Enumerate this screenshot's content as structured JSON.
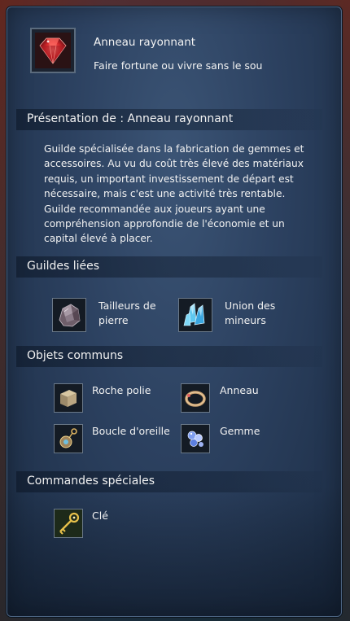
{
  "header": {
    "title": "Anneau rayonnant",
    "subtitle": "Faire fortune ou vivre sans le sou",
    "icon": "ruby-gem-icon"
  },
  "presentation": {
    "heading": "Présentation de : Anneau rayonnant",
    "text": "Guilde spécialisée dans la fabrication de gemmes et accessoires. Au vu du coût très élevé des matériaux requis, un important investissement de départ est nécessaire, mais c'est une activité très rentable. Guilde recommandée aux joueurs ayant une compréhension approfondie de l'économie et un capital élevé à placer."
  },
  "related_guilds": {
    "heading": "Guildes liées",
    "items": [
      {
        "line1": "Tailleurs de",
        "line2": "pierre",
        "icon": "rough-stone-icon"
      },
      {
        "line1": "Union des",
        "line2": "mineurs",
        "icon": "blue-crystal-icon"
      }
    ]
  },
  "common_items": {
    "heading": "Objets communs",
    "items": [
      {
        "label": "Roche polie",
        "icon": "polished-stone-icon"
      },
      {
        "label": "Anneau",
        "icon": "ring-icon"
      },
      {
        "label": "Boucle d'oreille",
        "icon": "earring-icon"
      },
      {
        "label": "Gemme",
        "icon": "gem-cluster-icon"
      }
    ]
  },
  "special_orders": {
    "heading": "Commandes spéciales",
    "items": [
      {
        "label": "Clé",
        "icon": "golden-key-icon"
      }
    ]
  },
  "colors": {
    "panel": "#2c4160",
    "text": "#f2f2f2",
    "ruby": "#c8262a"
  }
}
